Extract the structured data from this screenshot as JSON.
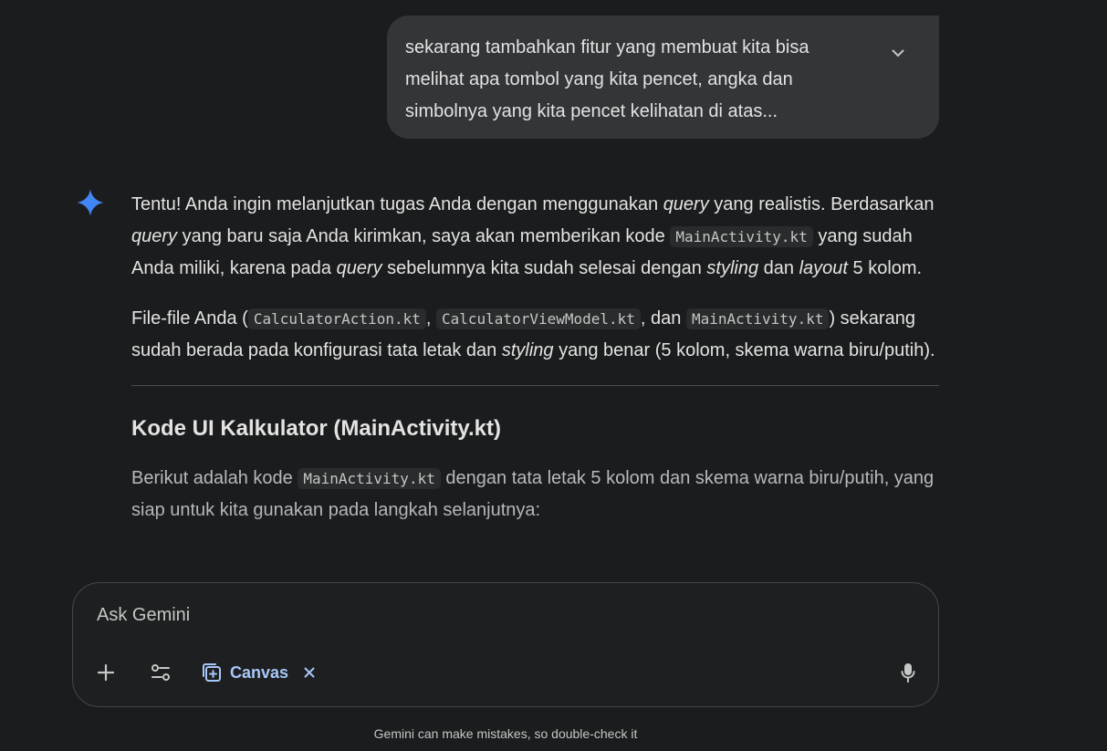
{
  "user_message": {
    "lines": [
      "sekarang tambahkan fitur yang membuat kita bisa",
      "melihat apa tombol yang kita pencet, angka dan",
      "simbolnya yang kita pencet kelihatan di atas..."
    ]
  },
  "response": {
    "p1": {
      "t1": "Tentu! Anda ingin melanjutkan tugas Anda dengan menggunakan ",
      "e1": "query",
      "t2": " yang realistis. Berdasarkan ",
      "e2": "query",
      "t3": " yang baru saja Anda kirimkan, saya akan memberikan kode ",
      "c1": "MainActivity.kt",
      "t4": " yang sudah Anda miliki, karena pada ",
      "e3": "query",
      "t5": " sebelumnya kita sudah selesai dengan ",
      "e4": "styling",
      "t6": " dan ",
      "e5": "layout",
      "t7": " 5 kolom."
    },
    "p2": {
      "t1": "File-file Anda (",
      "c1": "CalculatorAction.kt",
      "t2": ", ",
      "c2": "CalculatorViewModel.kt",
      "t3": ", dan ",
      "c3": "MainActivity.kt",
      "t4": ") sekarang sudah berada pada konfigurasi tata letak dan ",
      "e1": "styling",
      "t5": " yang benar (5 kolom, skema warna biru/putih)."
    },
    "heading": "Kode UI Kalkulator (MainActivity.kt)",
    "p3": {
      "t1": "Berikut adalah kode ",
      "c1": "MainActivity.kt",
      "t2": " dengan tata letak 5 kolom dan skema warna biru/putih, yang siap untuk kita gunakan pada langkah selanjutnya:"
    }
  },
  "input": {
    "placeholder": "Ask Gemini",
    "canvas_label": "Canvas"
  },
  "disclaimer": "Gemini can make mistakes, so double-check it",
  "icons": {
    "expand": "chevron-down-icon",
    "spark": "gemini-spark-icon",
    "add": "plus-icon",
    "tools": "tune-icon",
    "canvas": "canvas-icon",
    "close": "close-icon",
    "mic": "mic-icon"
  },
  "colors": {
    "background": "#1b1c1d",
    "bubble": "#333537",
    "accent": "#a8c7fa",
    "spark": "#4285f4"
  }
}
